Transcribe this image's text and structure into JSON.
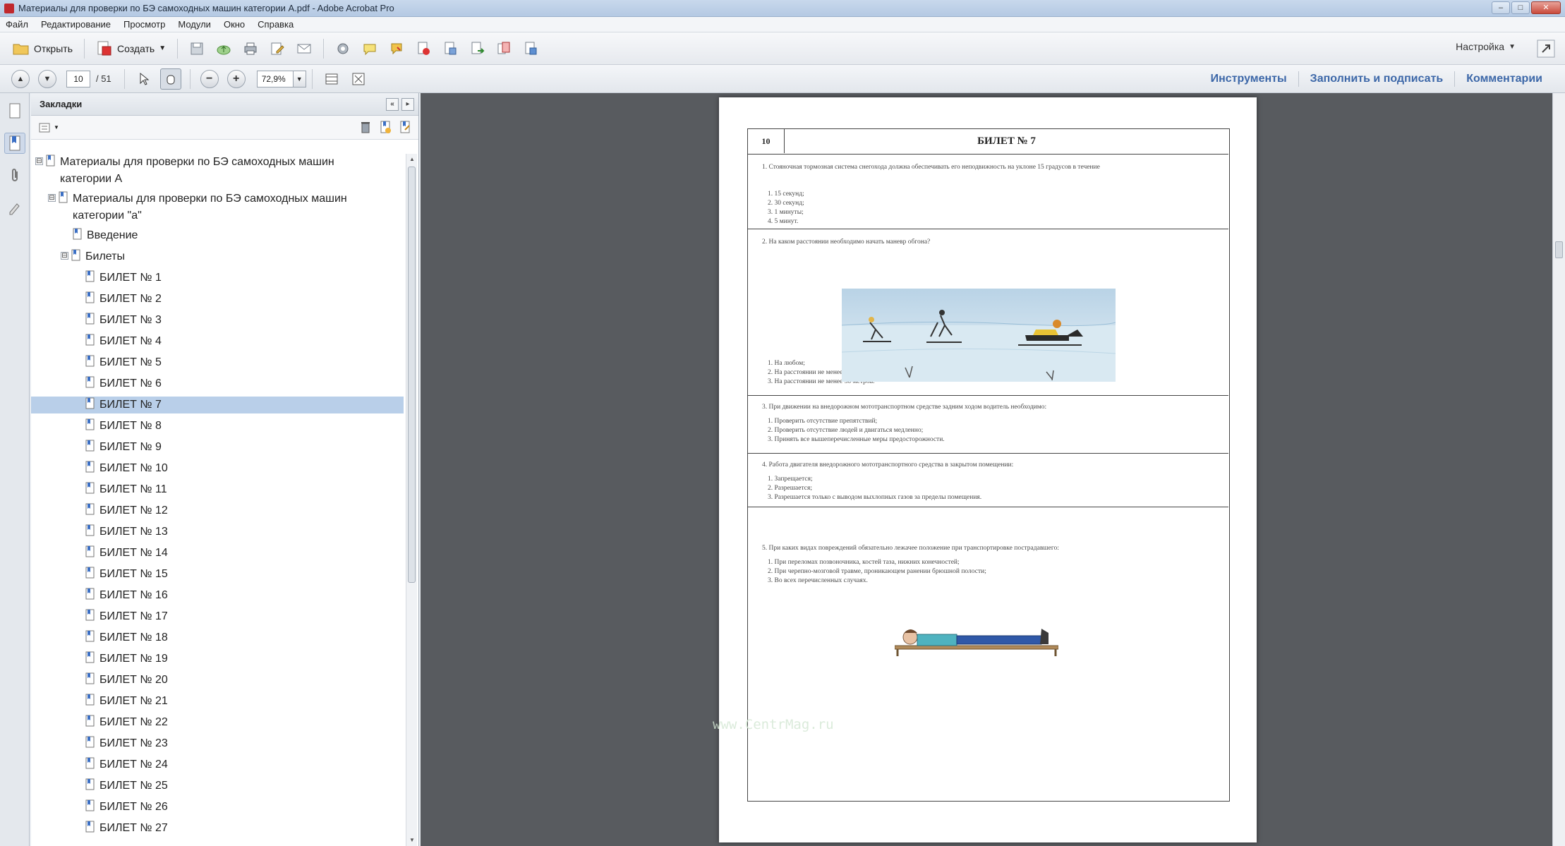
{
  "window": {
    "title": "Материалы для проверки по БЭ самоходных машин категории А.pdf - Adobe Acrobat Pro",
    "controls": [
      "–",
      "□",
      "✕"
    ]
  },
  "menu": [
    "Файл",
    "Редактирование",
    "Просмотр",
    "Модули",
    "Окно",
    "Справка"
  ],
  "toolbar": {
    "open_label": "Открыть",
    "create_label": "Создать",
    "settings_label": "Настройка"
  },
  "nav": {
    "page_current": "10",
    "page_total": "/ 51",
    "zoom": "72,9%",
    "panels": [
      "Инструменты",
      "Заполнить и подписать",
      "Комментарии"
    ]
  },
  "bookmarks": {
    "header": "Закладки",
    "root_title": "Материалы для проверки по БЭ самоходных машин категории А",
    "sub_title": "Материалы для проверки по БЭ самоходных машин категории \"а\"",
    "intro": "Введение",
    "tickets_folder": "Билеты",
    "tickets": [
      "БИЛЕТ № 1",
      "БИЛЕТ № 2",
      "БИЛЕТ № 3",
      "БИЛЕТ № 4",
      "БИЛЕТ № 5",
      "БИЛЕТ № 6",
      "БИЛЕТ № 7",
      "БИЛЕТ № 8",
      "БИЛЕТ № 9",
      "БИЛЕТ № 10",
      "БИЛЕТ № 11",
      "БИЛЕТ № 12",
      "БИЛЕТ № 13",
      "БИЛЕТ № 14",
      "БИЛЕТ № 15",
      "БИЛЕТ № 16",
      "БИЛЕТ № 17",
      "БИЛЕТ № 18",
      "БИЛЕТ № 19",
      "БИЛЕТ № 20",
      "БИЛЕТ № 21",
      "БИЛЕТ № 22",
      "БИЛЕТ № 23",
      "БИЛЕТ № 24",
      "БИЛЕТ № 25",
      "БИЛЕТ № 26",
      "БИЛЕТ № 27"
    ],
    "selected_index": 6
  },
  "document": {
    "page_number": "10",
    "ticket_title": "БИЛЕТ № 7",
    "questions": [
      {
        "text": "1. Стояночная тормозная система снегохода должна обеспечивать его неподвижность на уклоне 15 градусов в течение",
        "answers": [
          "1. 15 секунд;",
          "2. 30 секунд;",
          "3. 1 минуты;",
          "4. 5 минут."
        ]
      },
      {
        "text": "2. На каком расстоянии необходимо начать маневр обгона?",
        "answers": [
          "1. На любом;",
          "2. На расстоянии не менее 10 метров;",
          "3. На расстоянии не менее 30 метров."
        ]
      },
      {
        "text": "3. При движении на внедорожном мототранспортном средстве задним ходом водитель необходимо:",
        "answers": [
          "1. Проверить отсутствие препятствий;",
          "2. Проверить отсутствие людей и двигаться медленно;",
          "3. Принять все вышеперечисленные меры предосторожности."
        ]
      },
      {
        "text": "4. Работа двигателя внедорожного мототранспортного средства в закрытом помещении:",
        "answers": [
          "1. Запрещается;",
          "2. Разрешается;",
          "3. Разрешается только с выводом выхлопных газов за пределы помещения."
        ]
      },
      {
        "text": "5. При каких видах повреждений обязательно лежачее положение при транспортировке пострадавшего:",
        "answers": [
          "1. При переломах позвоночника, костей таза, нижних конечностей;",
          "2. При черепно-мозговой травме, проникающем ранении брюшной полости;",
          "3. Во всех перечисленных случаях."
        ]
      }
    ],
    "watermark": "www.CentrMag.ru"
  },
  "colors": {
    "doc_background": "#585b5f",
    "selection": "#b9cfe9",
    "panel_link": "#3c67a8"
  }
}
